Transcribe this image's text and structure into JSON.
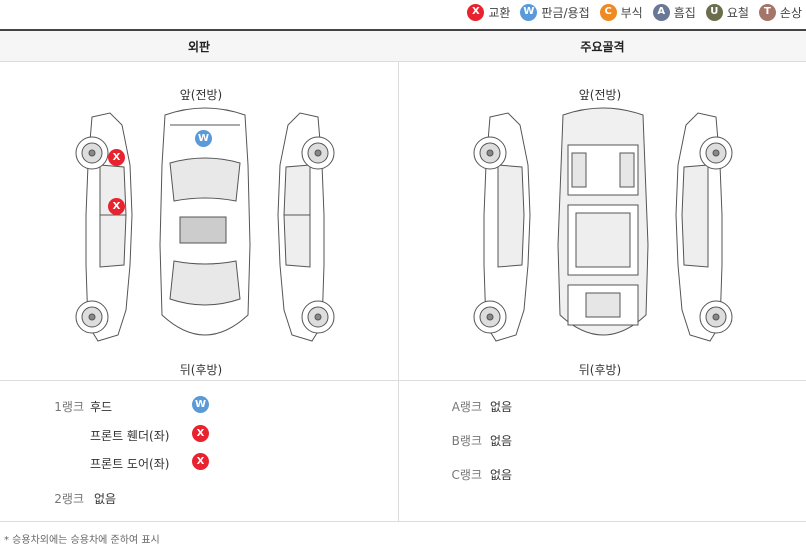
{
  "legend": [
    {
      "code": "X",
      "label": "교환",
      "color": "#e8232f"
    },
    {
      "code": "W",
      "label": "판금/용접",
      "color": "#5a9ad9"
    },
    {
      "code": "C",
      "label": "부식",
      "color": "#ef8a22"
    },
    {
      "code": "A",
      "label": "흠집",
      "color": "#6b7796"
    },
    {
      "code": "U",
      "label": "요철",
      "color": "#6b6d4c"
    },
    {
      "code": "T",
      "label": "손상",
      "color": "#a5756a"
    }
  ],
  "headers": {
    "exterior": "외판",
    "frame": "주요골격"
  },
  "directions": {
    "front": "앞(전방)",
    "rear": "뒤(후방)"
  },
  "markers": {
    "hood": "W",
    "front_fender": "X",
    "front_door": "X"
  },
  "exterior_ranks": {
    "rank1_label": "1랭크",
    "rank1_items": [
      {
        "part": "후드",
        "code": "W"
      },
      {
        "part": "프론트 휀더(좌)",
        "code": "X"
      },
      {
        "part": "프론트 도어(좌)",
        "code": "X"
      }
    ],
    "rank2_label": "2랭크",
    "rank2_value": "없음"
  },
  "frame_ranks": [
    {
      "label": "A랭크",
      "value": "없음"
    },
    {
      "label": "B랭크",
      "value": "없음"
    },
    {
      "label": "C랭크",
      "value": "없음"
    }
  ],
  "footnote": "* 승용차외에는 승용차에 준하여 표시"
}
